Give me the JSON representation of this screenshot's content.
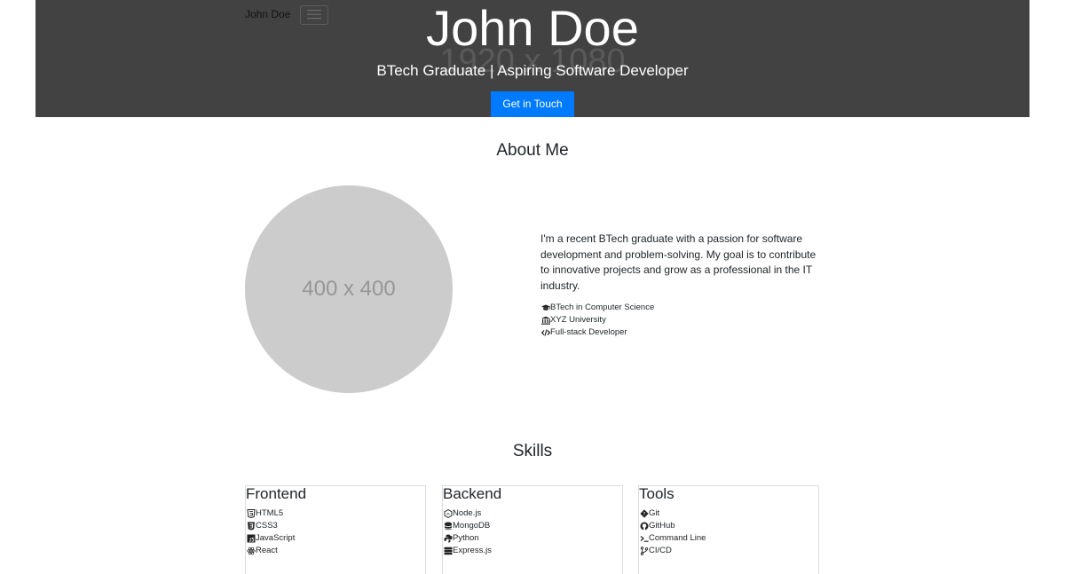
{
  "nav": {
    "brand": "John Doe",
    "toggler_icon": "hamburger-icon"
  },
  "hero": {
    "watermark": "1920 x 1080",
    "title": "John Doe",
    "subtitle": "BTech Graduate | Aspiring Software Developer",
    "cta_label": "Get in Touch",
    "background": "#424242",
    "cta_color": "#007bff"
  },
  "about": {
    "heading": "About Me",
    "avatar_placeholder": "400 x 400",
    "bio": "I'm a recent BTech graduate with a passion for software development and problem-solving. My goal is to contribute to innovative projects and grow as a professional in the IT industry.",
    "facts": [
      {
        "icon": "graduation-cap-icon",
        "label": "BTech in Computer Science"
      },
      {
        "icon": "university-icon",
        "label": "XYZ University"
      },
      {
        "icon": "code-icon",
        "label": "Full-stack Developer"
      }
    ]
  },
  "skills": {
    "heading": "Skills",
    "groups": [
      {
        "title": "Frontend",
        "items": [
          {
            "icon": "html5-icon",
            "label": "HTML5"
          },
          {
            "icon": "css3-icon",
            "label": "CSS3"
          },
          {
            "icon": "javascript-icon",
            "label": "JavaScript"
          },
          {
            "icon": "react-icon",
            "label": "React"
          }
        ]
      },
      {
        "title": "Backend",
        "items": [
          {
            "icon": "nodejs-icon",
            "label": "Node.js"
          },
          {
            "icon": "database-icon",
            "label": "MongoDB"
          },
          {
            "icon": "python-icon",
            "label": "Python"
          },
          {
            "icon": "server-icon",
            "label": "Express.js"
          }
        ]
      },
      {
        "title": "Tools",
        "items": [
          {
            "icon": "git-icon",
            "label": "Git"
          },
          {
            "icon": "github-icon",
            "label": "GitHub"
          },
          {
            "icon": "terminal-icon",
            "label": "Command Line"
          },
          {
            "icon": "code-branch-icon",
            "label": "CI/CD"
          }
        ]
      }
    ]
  }
}
